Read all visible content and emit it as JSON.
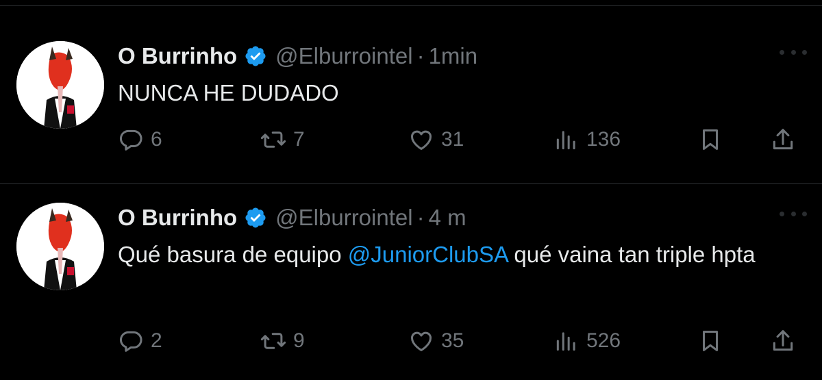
{
  "tweets": [
    {
      "author_name": "O Burrinho",
      "handle": "@Elburrointel",
      "separator": "·",
      "time": "1min",
      "text_parts": {
        "before": "NUNCA HE DUDADO",
        "mention": "",
        "after": ""
      },
      "replies": "6",
      "retweets": "7",
      "likes": "31",
      "views": "136"
    },
    {
      "author_name": "O Burrinho",
      "handle": "@Elburrointel",
      "separator": "·",
      "time": "4 m",
      "text_parts": {
        "before": "Qué basura de equipo ",
        "mention": "@JuniorClubSA",
        "after": " qué vaina tan triple hpta"
      },
      "replies": "2",
      "retweets": "9",
      "likes": "35",
      "views": "526"
    }
  ],
  "icons": {
    "verified": "verified-badge-icon",
    "reply": "reply-icon",
    "retweet": "retweet-icon",
    "like": "heart-icon",
    "views": "views-icon",
    "bookmark": "bookmark-icon",
    "share": "share-icon",
    "more": "more-icon"
  },
  "colors": {
    "background": "#000000",
    "text": "#e7e9ea",
    "muted": "#71767b",
    "accent": "#1d9bf0",
    "divider": "#2f3336"
  }
}
